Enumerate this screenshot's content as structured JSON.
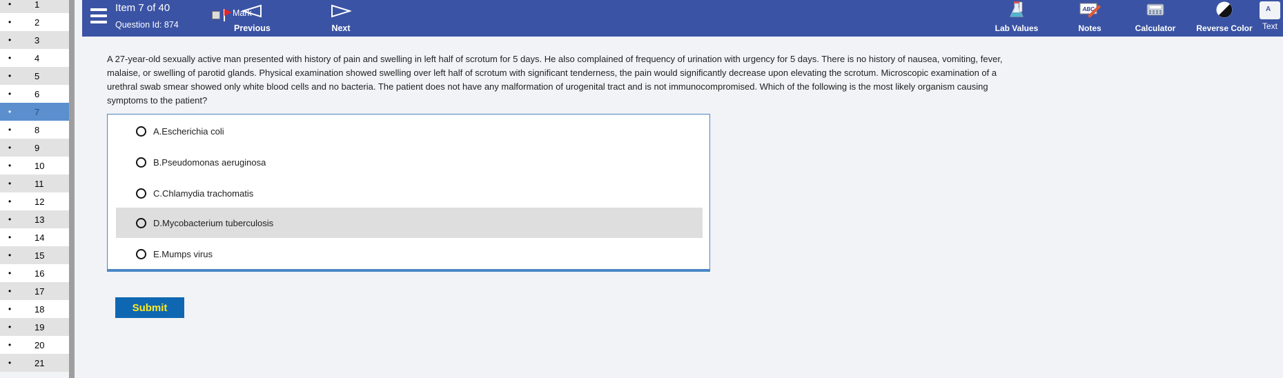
{
  "sidebar": {
    "items": [
      {
        "num": "1"
      },
      {
        "num": "2"
      },
      {
        "num": "3"
      },
      {
        "num": "4"
      },
      {
        "num": "5"
      },
      {
        "num": "6"
      },
      {
        "num": "7",
        "active": true
      },
      {
        "num": "8"
      },
      {
        "num": "9"
      },
      {
        "num": "10"
      },
      {
        "num": "11"
      },
      {
        "num": "12"
      },
      {
        "num": "13"
      },
      {
        "num": "14"
      },
      {
        "num": "15"
      },
      {
        "num": "16"
      },
      {
        "num": "17"
      },
      {
        "num": "18"
      },
      {
        "num": "19"
      },
      {
        "num": "20"
      },
      {
        "num": "21"
      }
    ],
    "bullet": "•"
  },
  "header": {
    "item_title": "Item 7 of 40",
    "question_id": "Question Id: 874",
    "mark_label": "Mark",
    "previous_label": "Previous",
    "next_label": "Next",
    "tools": {
      "lab_values": "Lab Values",
      "notes": "Notes",
      "calculator": "Calculator",
      "reverse_color": "Reverse Color",
      "text": "Text",
      "text_icon_letter": "A",
      "notes_icon_text": "ABC"
    }
  },
  "question": {
    "stem": "A 27-year-old sexually active man presented with history of pain and swelling in left half of scrotum for 5 days. He also complained of frequency of urination with urgency for 5 days. There is no history of nausea, vomiting, fever, malaise, or swelling of parotid glands. Physical examination showed swelling over left half of scrotum with significant tenderness, the pain would significantly decrease upon elevating the scrotum. Microscopic examination of a urethral swab smear showed only white blood cells and no bacteria. The patient does not have any malformation of urogenital tract and is not immunocompromised. Which of the following is the most likely organism causing symptoms to the patient?",
    "choices": [
      {
        "label": "A.Escherichia coli"
      },
      {
        "label": "B.Pseudomonas aeruginosa"
      },
      {
        "label": "C.Chlamydia trachomatis"
      },
      {
        "label": "D.Mycobacterium tuberculosis",
        "hovered": true
      },
      {
        "label": "E.Mumps virus"
      }
    ],
    "submit_label": "Submit"
  },
  "colors": {
    "header_bg": "#3a53a4",
    "active_row": "#5b8fce",
    "submit_bg": "#0f67b2",
    "submit_text": "#ffe91f",
    "answer_border": "#4a86c5"
  }
}
